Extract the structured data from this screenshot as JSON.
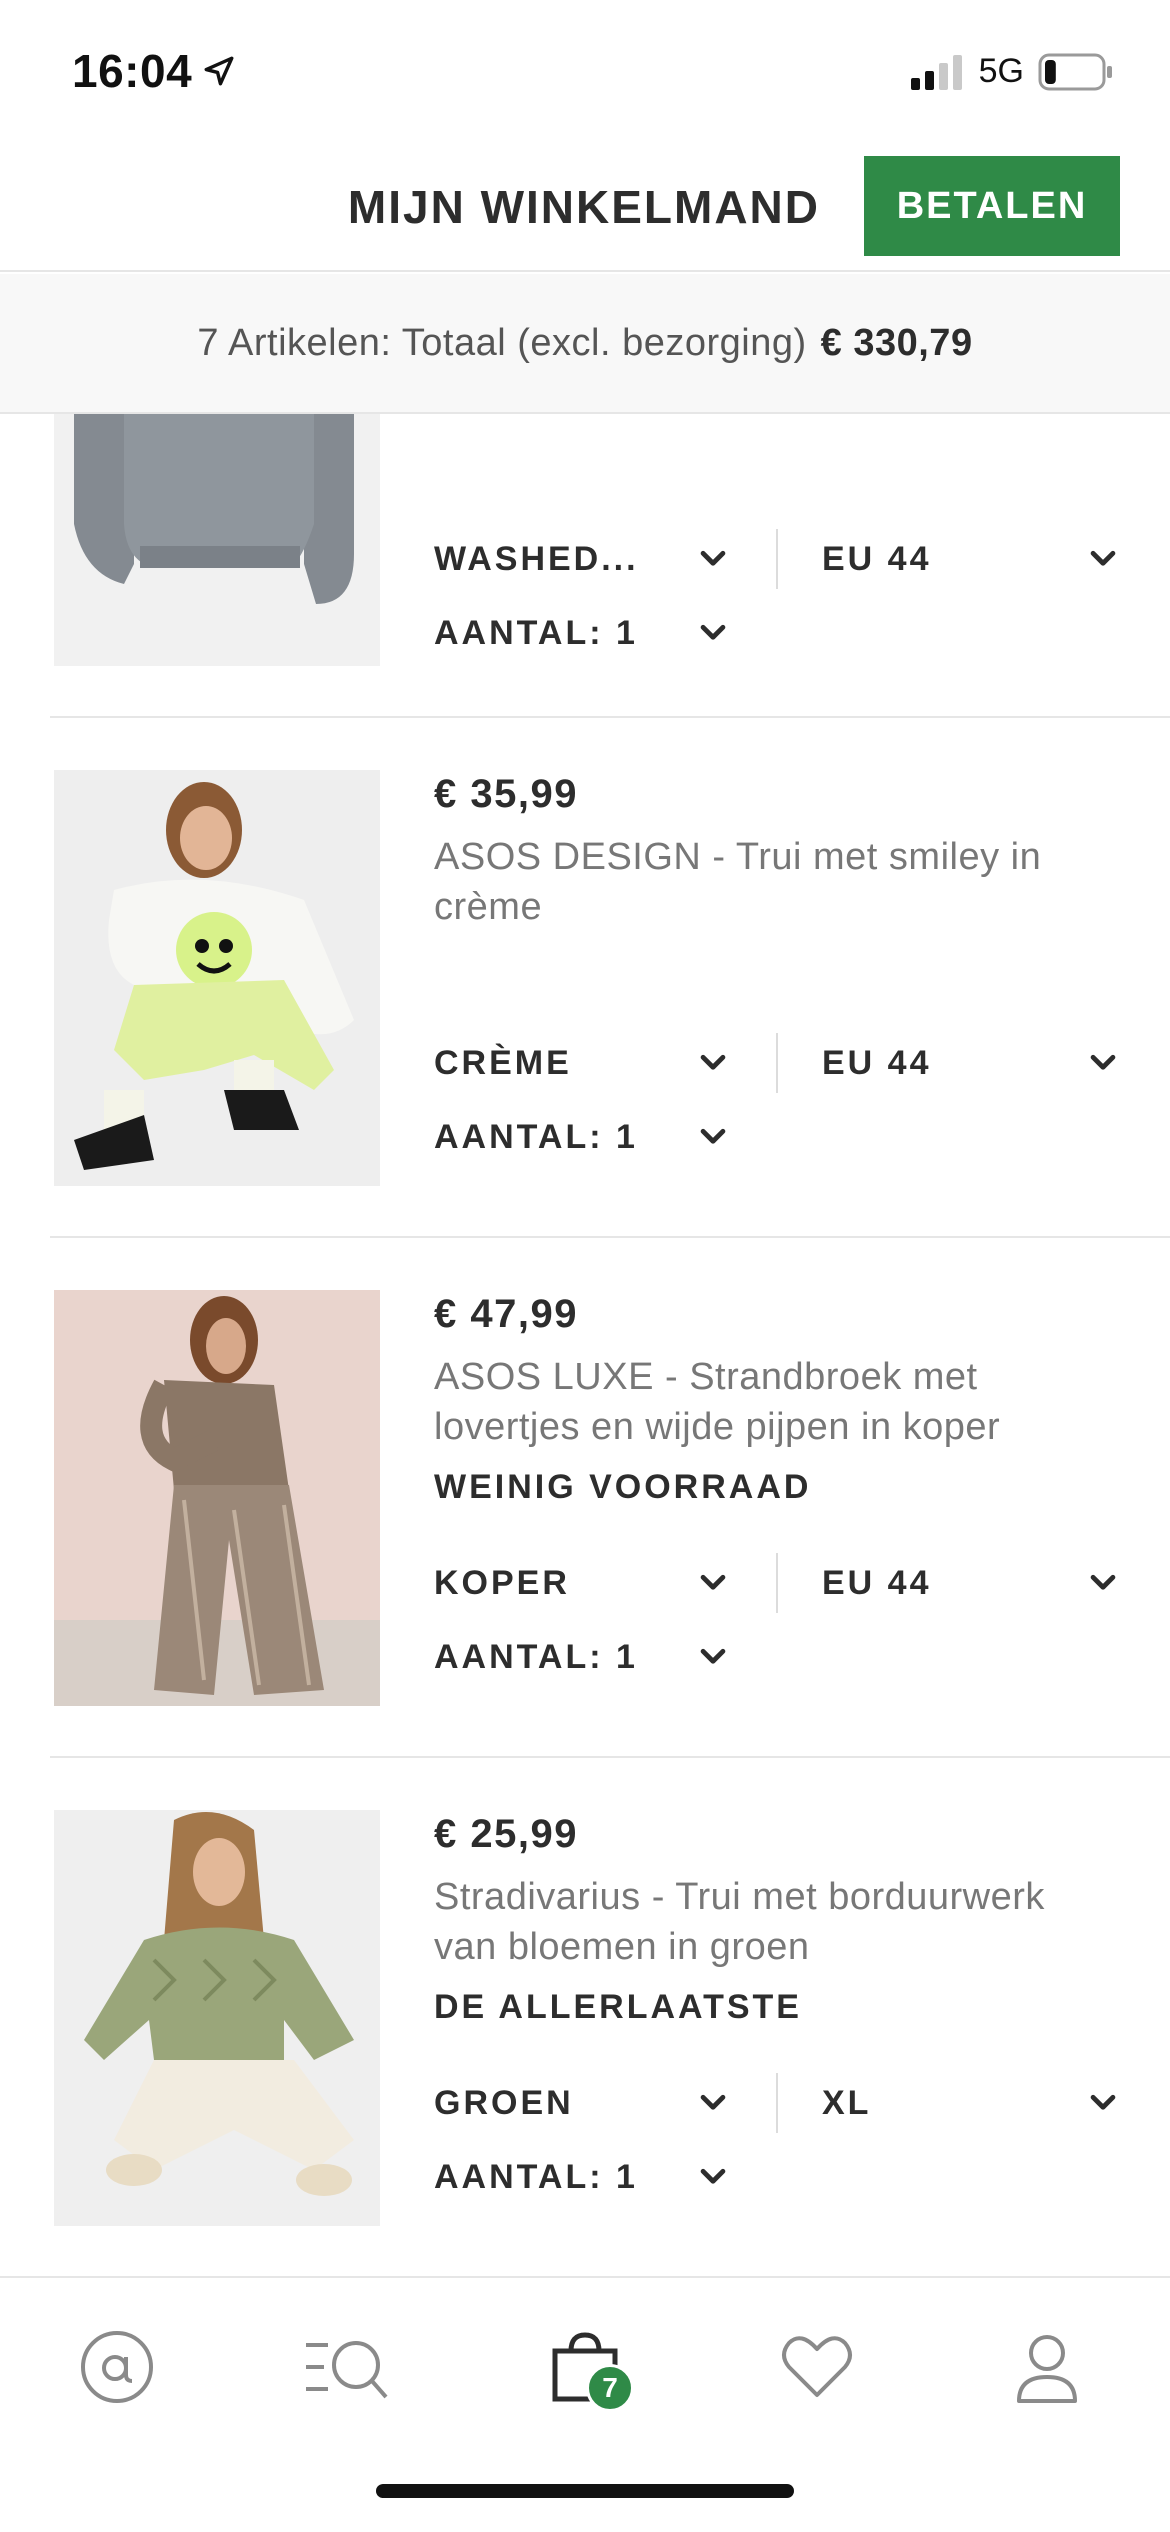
{
  "status_bar": {
    "time": "16:04",
    "network": "5G",
    "battery_level": 0.2
  },
  "header": {
    "title": "MIJN WINKELMAND",
    "pay_label": "BETALEN"
  },
  "summary": {
    "label": "7 Artikelen: Totaal (excl. bezorging)",
    "total": "€ 330,79"
  },
  "items": [
    {
      "color": "WASHED...",
      "size": "EU 44",
      "quantity": "AANTAL: 1"
    },
    {
      "price": "€ 35,99",
      "name": "ASOS DESIGN - Trui met smiley in crème",
      "color": "CRÈME",
      "size": "EU 44",
      "quantity": "AANTAL: 1"
    },
    {
      "price": "€ 47,99",
      "name": "ASOS LUXE - Strandbroek met lovertjes en wijde pijpen in koper",
      "stock": "WEINIG VOORRAAD",
      "color": "KOPER",
      "size": "EU 44",
      "quantity": "AANTAL: 1"
    },
    {
      "price": "€ 25,99",
      "name": "Stradivarius - Trui met borduurwerk van bloemen in groen",
      "stock": "DE ALLERLAATSTE",
      "color": "GROEN",
      "size": "XL",
      "quantity": "AANTAL: 1"
    }
  ],
  "nav": {
    "bag_count": "7",
    "items": [
      "home-icon",
      "search-icon",
      "bag-icon",
      "heart-icon",
      "account-icon"
    ]
  },
  "colors": {
    "accent": "#2f8a47",
    "text": "#2d2d2d",
    "muted": "#777777"
  }
}
